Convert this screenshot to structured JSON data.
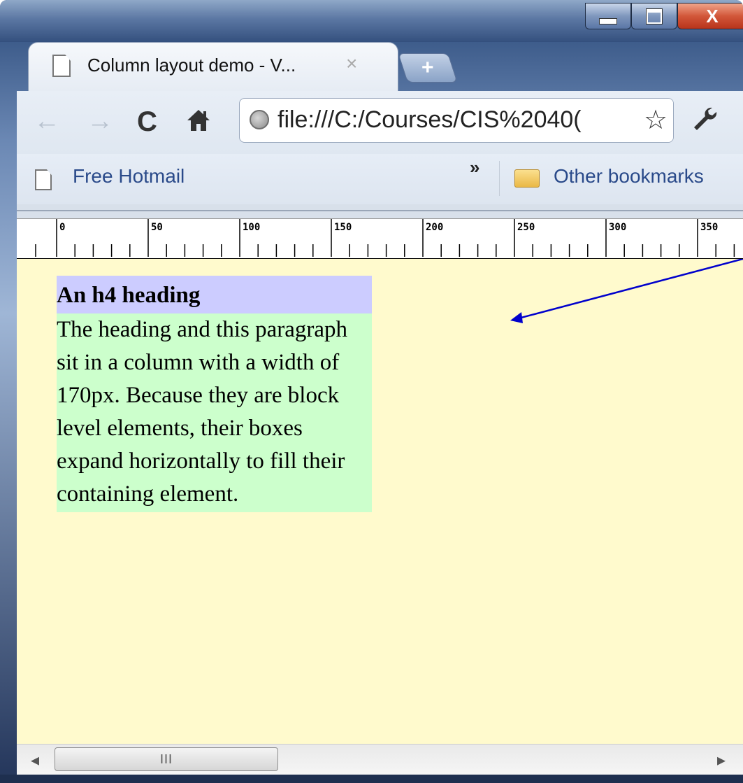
{
  "tab": {
    "title": "Column layout demo - V...",
    "close_glyph": "×"
  },
  "new_tab": {
    "glyph": "+"
  },
  "window_controls": {
    "close_glyph": "X"
  },
  "toolbar": {
    "back_glyph": "←",
    "forward_glyph": "→",
    "reload_glyph": "C",
    "home_glyph": "🏠",
    "url": "file:///C:/Courses/CIS%2040(",
    "star_glyph": "☆",
    "wrench_glyph": "🔧"
  },
  "bookmarks": {
    "free_hotmail": "Free Hotmail",
    "chevron": "»",
    "other": "Other bookmarks"
  },
  "ruler": {
    "labels": [
      "0",
      "50",
      "100",
      "150",
      "200",
      "250",
      "300",
      "350"
    ]
  },
  "content": {
    "heading": "An h4 heading",
    "paragraph": "The heading and this paragraph sit in a column with a width of 170px. Because they are block level elements, their boxes expand horizontally to fill their containing element."
  },
  "scrollbar": {
    "left_arrow": "◂",
    "right_arrow": "▸",
    "grip": "III"
  },
  "colors": {
    "page_background": "#fffacd",
    "heading_background": "#ccccff",
    "paragraph_background": "#ccffcc",
    "annotation_arrow": "#0000cc"
  }
}
